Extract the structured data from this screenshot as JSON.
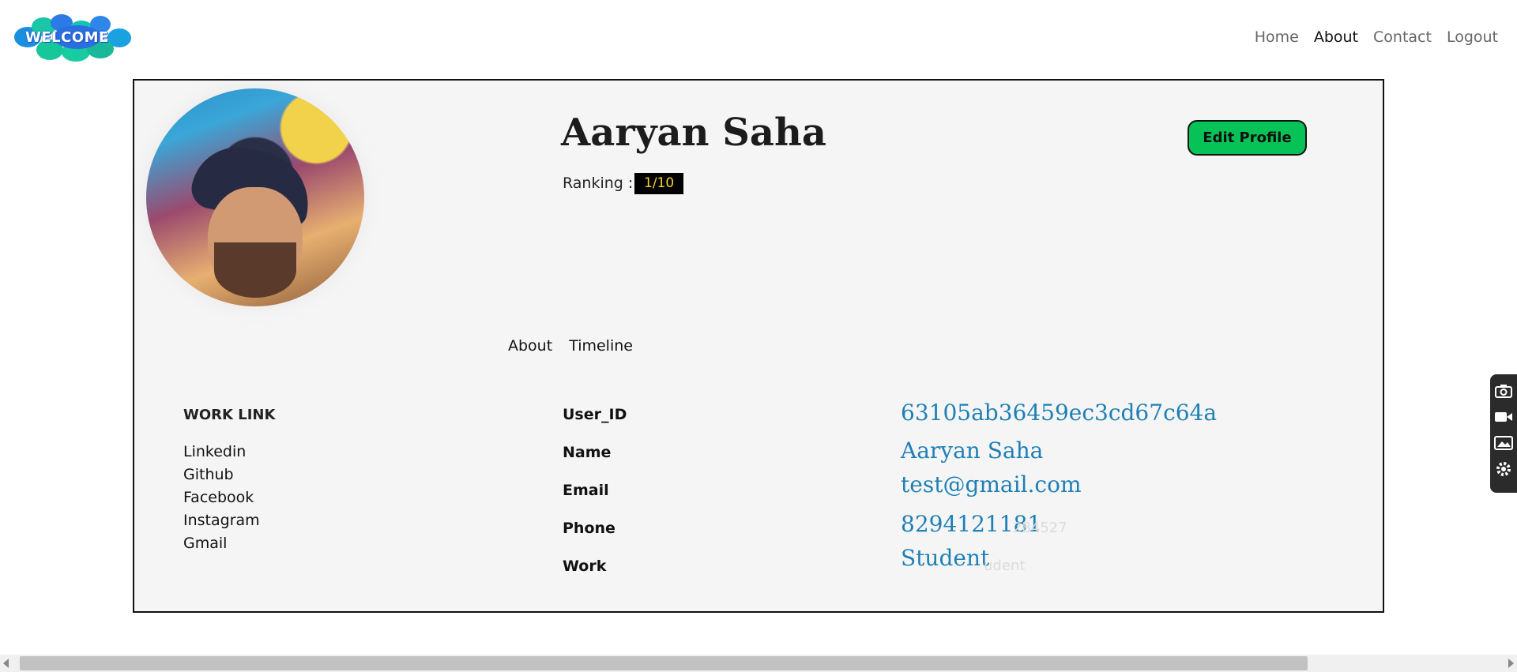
{
  "logo": {
    "text": "WELCOME"
  },
  "nav": {
    "items": [
      {
        "label": "Home",
        "active": false
      },
      {
        "label": "About",
        "active": true
      },
      {
        "label": "Contact",
        "active": false
      },
      {
        "label": "Logout",
        "active": false
      }
    ]
  },
  "profile": {
    "name": "Aaryan Saha",
    "ranking_label": "Ranking :",
    "ranking_value": "1/10",
    "edit_button": "Edit Profile",
    "tabs": [
      "About",
      "Timeline"
    ]
  },
  "work_links": {
    "title": "WORK LINK",
    "items": [
      "Linkedin",
      "Github",
      "Facebook",
      "Instagram",
      "Gmail"
    ]
  },
  "details": {
    "user_id_label": "User_ID",
    "user_id_value": "63105ab36459ec3cd67c64a",
    "name_label": "Name",
    "name_value": "Aaryan Saha",
    "email_label": "Email",
    "email_value": "test@gmail.com",
    "phone_label": "Phone",
    "phone_value": "8294121181",
    "phone_ghost": "284527",
    "work_label": "Work",
    "work_value": "Student",
    "work_ghost": "udent"
  },
  "side_toolbar": {
    "icons": [
      "camera-icon",
      "video-icon",
      "gallery-icon",
      "settings-icon"
    ]
  },
  "colors": {
    "accent_green": "#06c257",
    "value_blue": "#1f7fb6",
    "ranking_text": "#f5d22d",
    "card_bg": "#f5f5f5"
  }
}
